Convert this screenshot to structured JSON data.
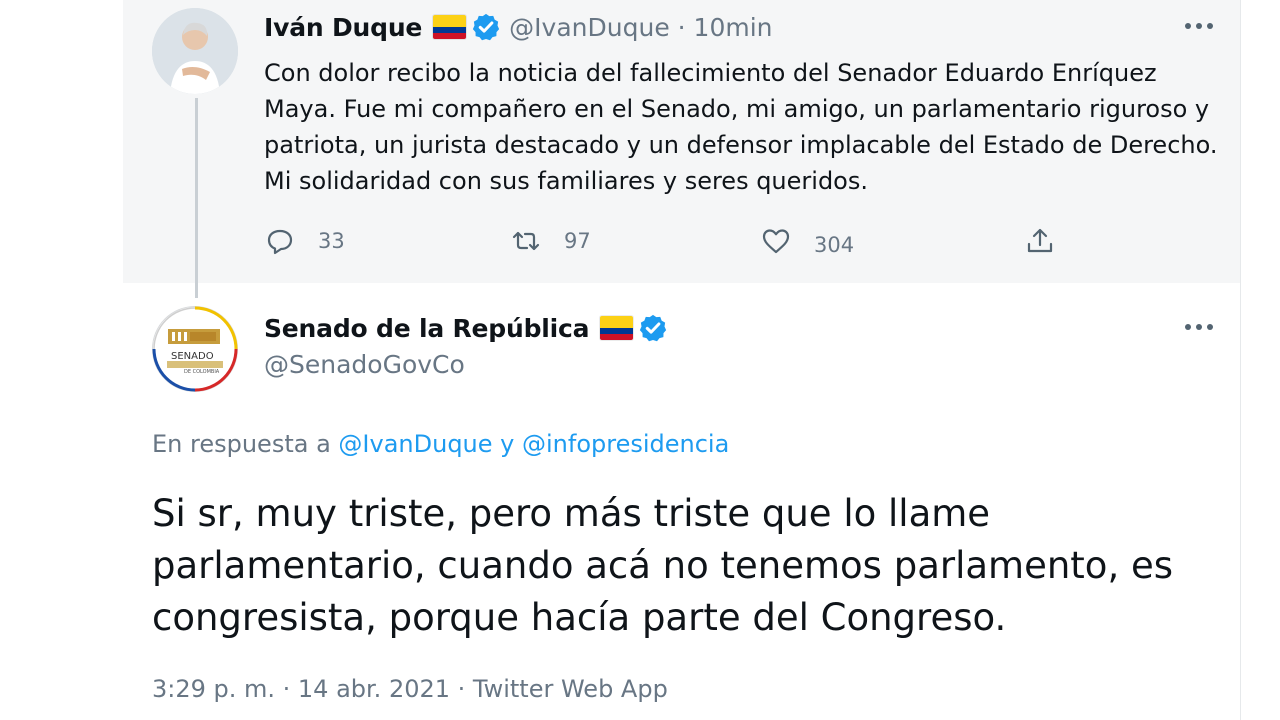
{
  "first_tweet": {
    "display_name": "Iván Duque",
    "handle_time": "@IvanDuque · 10min",
    "text": "Con dolor recibo la noticia del fallecimiento del Senador Eduardo Enríquez Maya. Fue mi compañero en el Senado, mi amigo, un parlamentario riguroso y patriota, un jurista destacado y un defensor implacable del Estado de Derecho. Mi solidaridad con sus familiares y seres queridos.",
    "replies": "33",
    "retweets": "97",
    "likes": "304"
  },
  "reply_tweet": {
    "display_name": "Senado de la República",
    "handle": "@SenadoGovCo",
    "reply_prefix": "En respuesta a ",
    "reply_user1": "@IvanDuque",
    "reply_and": " y ",
    "reply_user2": "@infopresidencia",
    "text": "Si sr, muy triste, pero más triste que lo llame parlamentario, cuando acá no tenemos parlamento, es congresista, porque hacía parte del Congreso.",
    "meta": "3:29 p. m. · 14 abr. 2021 · Twitter Web App"
  },
  "icons": {
    "flag": "colombia-flag-icon",
    "verified": "verified-badge-icon",
    "more": "more-options-icon",
    "reply": "reply-icon",
    "retweet": "retweet-icon",
    "like": "like-icon",
    "share": "share-icon"
  },
  "colors": {
    "link": "#1d9bf0",
    "verified": "#1d9bf0",
    "secondary_text": "#687684",
    "first_tweet_background": "#f5f6f7"
  },
  "logo_text": {
    "line1": "SENADO",
    "line2": "DE COLOMBIA"
  }
}
